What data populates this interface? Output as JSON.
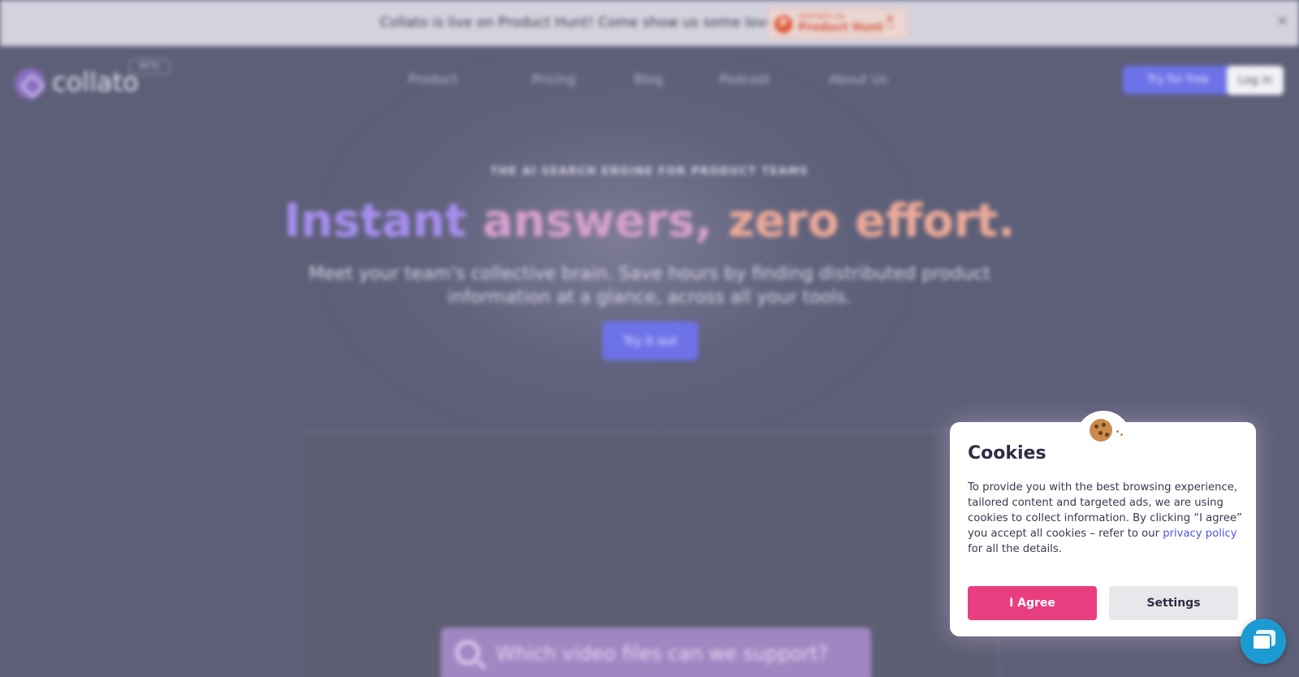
{
  "announcement": {
    "text": "Collato is live on Product Hunt! Come show us some love!",
    "badge": {
      "featured_on": "FEATURED ON",
      "name": "Product Hunt",
      "upvote_arrow": "▲",
      "upvotes": "••"
    },
    "close_glyph": "×"
  },
  "header": {
    "logo_text": "collato",
    "beta_label": "BETA",
    "nav": [
      {
        "label": "Product"
      },
      {
        "label": "Pricing"
      },
      {
        "label": "Blog"
      },
      {
        "label": "Podcast"
      },
      {
        "label": "About Us"
      }
    ],
    "try_free_label": "Try for free",
    "login_label": "Log in"
  },
  "hero": {
    "eyebrow": "THE AI SEARCH ENGINE FOR PRODUCT TEAMS",
    "headline_part1": "Instant",
    "headline_part2": "answers,",
    "headline_part3": "zero effort.",
    "subline": "Meet your team's collective brain. Save hours by finding distributed product information at a glance, across all your tools.",
    "cta_label": "Try it out",
    "demo_query": "Which video files can we support?"
  },
  "cookie_modal": {
    "title": "Cookies",
    "body_before_link": "To provide you with the best browsing experience, tailored content and targeted ads, we are using cookies to collect information. By clicking “I agree” you accept all cookies – refer to our ",
    "link_text": "privacy policy",
    "body_after_link": " for all the details.",
    "agree_label": "I Agree",
    "settings_label": "Settings"
  },
  "colors": {
    "accent_pink": "#e83e80",
    "link_blue": "#4b57e0",
    "chat_blue": "#1c9bd3",
    "primary_button": "#6d72e8"
  },
  "icons": {
    "cookie": "cookie-icon",
    "chat": "chat-icon",
    "search": "search-icon",
    "close": "close-icon"
  }
}
